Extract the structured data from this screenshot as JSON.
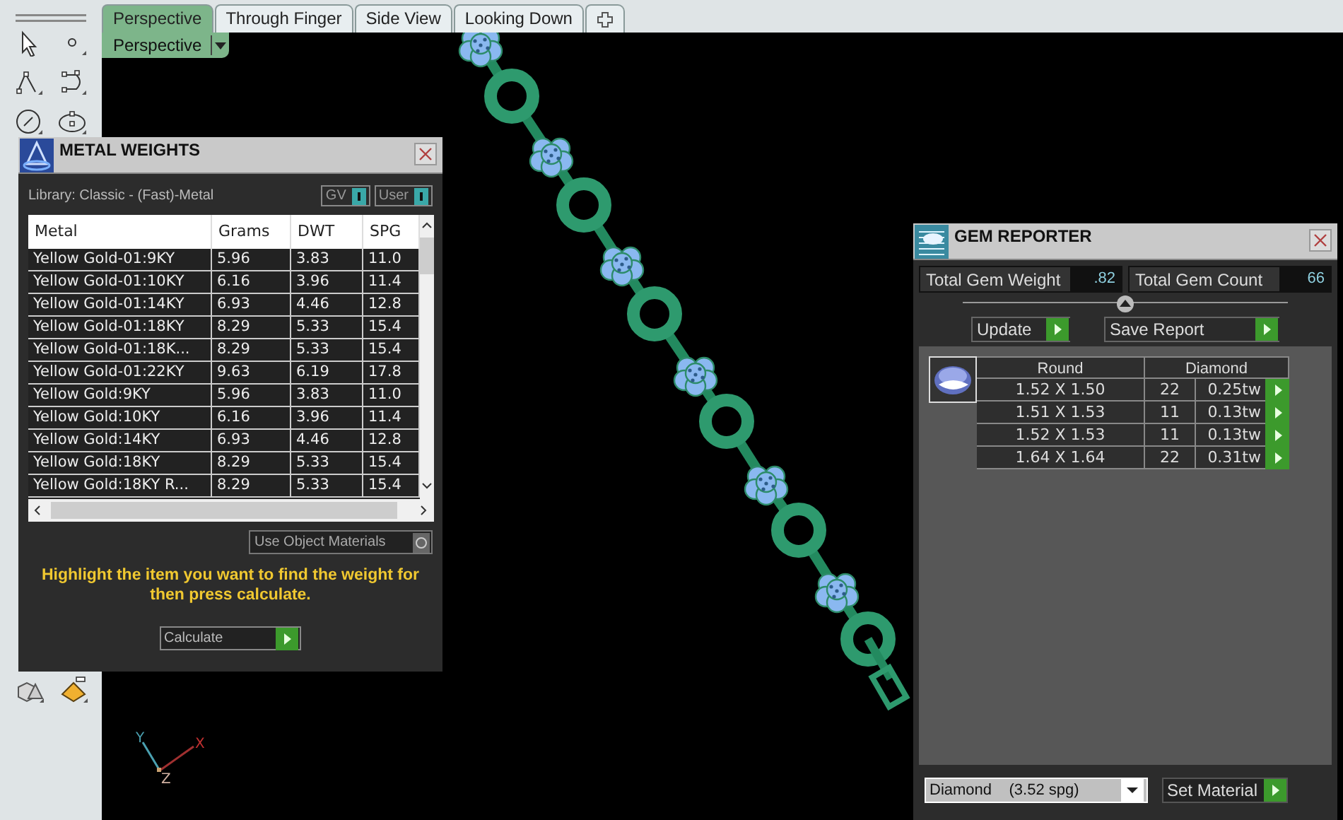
{
  "tabs": [
    {
      "label": "Perspective",
      "selected": true
    },
    {
      "label": "Through Finger",
      "selected": false
    },
    {
      "label": "Side View",
      "selected": false
    },
    {
      "label": "Looking Down",
      "selected": false
    }
  ],
  "viewport": {
    "label": "Perspective",
    "axis_labels": [
      "Y",
      "X",
      "Z"
    ]
  },
  "metal_weights": {
    "title": "METAL WEIGHTS",
    "library": "Library: Classic - (Fast)-Metal",
    "toggles": [
      "GV",
      "User"
    ],
    "columns": [
      "Metal",
      "Grams",
      "DWT",
      "SPG"
    ],
    "rows": [
      {
        "metal": "Yellow Gold-01:9KY",
        "grams": "5.96",
        "dwt": "3.83",
        "spg": "11.0"
      },
      {
        "metal": "Yellow Gold-01:10KY",
        "grams": "6.16",
        "dwt": "3.96",
        "spg": "11.4"
      },
      {
        "metal": "Yellow Gold-01:14KY",
        "grams": "6.93",
        "dwt": "4.46",
        "spg": "12.8"
      },
      {
        "metal": "Yellow Gold-01:18KY",
        "grams": "8.29",
        "dwt": "5.33",
        "spg": "15.4"
      },
      {
        "metal": "Yellow Gold-01:18K...",
        "grams": "8.29",
        "dwt": "5.33",
        "spg": "15.4"
      },
      {
        "metal": "Yellow Gold-01:22KY",
        "grams": "9.63",
        "dwt": "6.19",
        "spg": "17.8"
      },
      {
        "metal": "Yellow Gold:9KY",
        "grams": "5.96",
        "dwt": "3.83",
        "spg": "11.0"
      },
      {
        "metal": "Yellow Gold:10KY",
        "grams": "6.16",
        "dwt": "3.96",
        "spg": "11.4"
      },
      {
        "metal": "Yellow Gold:14KY",
        "grams": "6.93",
        "dwt": "4.46",
        "spg": "12.8"
      },
      {
        "metal": "Yellow Gold:18KY",
        "grams": "8.29",
        "dwt": "5.33",
        "spg": "15.4"
      },
      {
        "metal": "Yellow Gold:18KY R...",
        "grams": "8.29",
        "dwt": "5.33",
        "spg": "15.4"
      }
    ],
    "use_object_materials": "Use Object Materials",
    "message": "Highlight the item you want to find the weight for then press calculate.",
    "calculate_button": "Calculate"
  },
  "gem_reporter": {
    "title": "GEM REPORTER",
    "total_weight": {
      "label": "Total Gem Weight",
      "value": ".82"
    },
    "total_count": {
      "label": "Total Gem Count",
      "value": "66"
    },
    "buttons": [
      "Update",
      "Save Report"
    ],
    "columns": [
      "Round",
      "Diamond"
    ],
    "rows": [
      {
        "size": "1.52 X 1.50",
        "count": "22",
        "weight": "0.25tw"
      },
      {
        "size": "1.51 X 1.53",
        "count": "11",
        "weight": "0.13tw"
      },
      {
        "size": "1.52 X 1.53",
        "count": "11",
        "weight": "0.13tw"
      },
      {
        "size": "1.64 X 1.64",
        "count": "22",
        "weight": "0.31tw"
      }
    ],
    "material": "Diamond    (3.52 spg)",
    "set_material_button": "Set Material"
  }
}
